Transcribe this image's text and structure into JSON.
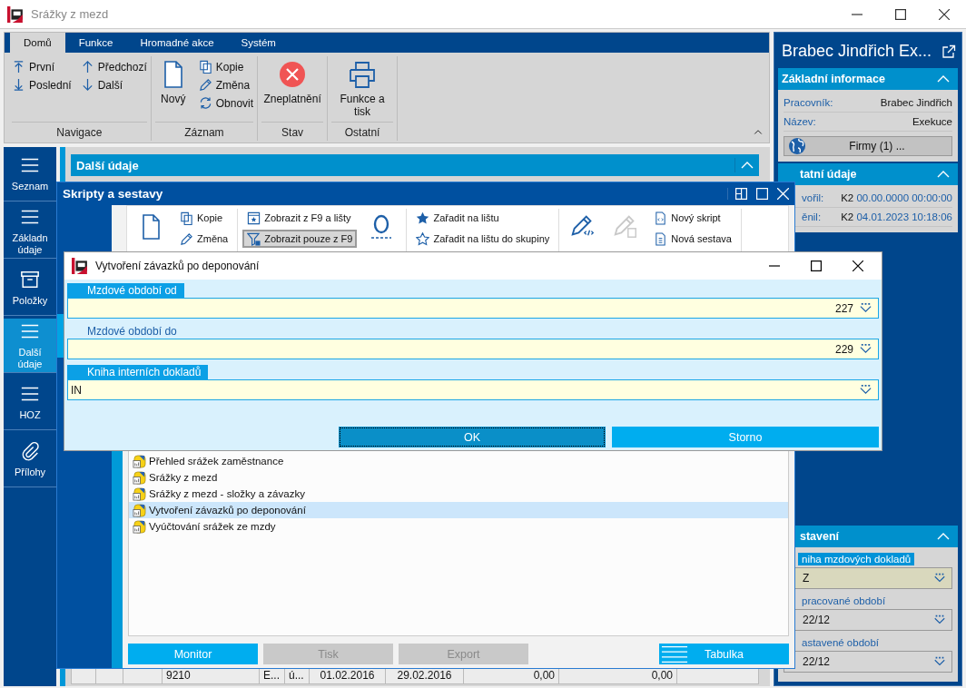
{
  "window": {
    "title": "Srážky z mezd"
  },
  "ribbon": {
    "tabs": [
      {
        "label": "Domů",
        "selected": true
      },
      {
        "label": "Funkce",
        "selected": false
      },
      {
        "label": "Hromadné akce",
        "selected": false
      },
      {
        "label": "Systém",
        "selected": false
      }
    ],
    "groups": [
      {
        "label": "Navigace",
        "small": [
          "První",
          "Předchozí",
          "Poslední",
          "Další"
        ]
      },
      {
        "label": "Záznam",
        "large": [
          "Nový"
        ],
        "small": [
          "Kopie",
          "Změna",
          "Obnovit"
        ]
      },
      {
        "label": "Stav",
        "large": [
          "Zneplatnění"
        ]
      },
      {
        "label": "Ostatní",
        "large": [
          "Funkce a tisk"
        ]
      }
    ]
  },
  "nav": [
    {
      "label": "Seznam",
      "selected": false
    },
    {
      "label": "Základn údaje",
      "selected": false
    },
    {
      "label": "Položky",
      "selected": false
    },
    {
      "label": "Další údaje",
      "selected": true
    },
    {
      "label": "HOZ",
      "selected": false
    },
    {
      "label": "Přílohy",
      "selected": false
    }
  ],
  "content": {
    "title": "Další údaje",
    "row": [
      "9210",
      "E...",
      "ú...",
      "01.02.2016",
      "29.02.2016",
      "0,00",
      "0,00"
    ]
  },
  "detail": {
    "title": "Brabec Jindřich Ex...",
    "info": {
      "title": "Základní informace",
      "rows": [
        {
          "label": "Pracovník:",
          "value": "Brabec Jindřich"
        },
        {
          "label": "Název:",
          "value": "Exekuce"
        }
      ],
      "button": "Firmy (1) ..."
    },
    "other": {
      "title": "tatní údaje",
      "rows": [
        {
          "label": "vořil:",
          "user": "K2",
          "date": "00.00.0000 00:00:00"
        },
        {
          "label": "ěnil:",
          "user": "K2",
          "date": "04.01.2023 10:18:06"
        }
      ]
    },
    "settings": {
      "title": "stavení",
      "fields": [
        {
          "label": "niha mzdových dokladů",
          "value": "Z",
          "highlighted": true
        },
        {
          "label": "pracované období",
          "value": "22/12",
          "highlighted": false
        },
        {
          "label": "astavené období",
          "value": "22/12",
          "highlighted": false
        }
      ]
    }
  },
  "scripts": {
    "title": "Skripty a sestavy",
    "toolbar": [
      {
        "label": "Kopie",
        "pressed": false
      },
      {
        "label": "Změna",
        "pressed": false
      },
      {
        "label": "Zobrazit z F9 a lišty",
        "pressed": false
      },
      {
        "label": "Zobrazit pouze z F9",
        "pressed": true
      },
      {
        "label": "Zařadit na lištu",
        "pressed": false
      },
      {
        "label": "Zařadit na lištu do skupiny",
        "pressed": false
      },
      {
        "label": "Nový skript",
        "pressed": false
      },
      {
        "label": "Nová sestava",
        "pressed": false
      }
    ],
    "list": [
      {
        "label": "Přehled srážek zaměstnance",
        "selected": false
      },
      {
        "label": "Srážky z mezd",
        "selected": false
      },
      {
        "label": "Srážky z mezd - složky a závazky",
        "selected": false
      },
      {
        "label": "Vytvoření závazků po deponování",
        "selected": true
      },
      {
        "label": "Vyúčtování srážek ze mzdy",
        "selected": false
      }
    ],
    "buttons": [
      {
        "label": "Monitor",
        "disabled": false
      },
      {
        "label": "Tisk",
        "disabled": true
      },
      {
        "label": "Export",
        "disabled": true
      },
      {
        "label": "Tabulka",
        "disabled": false
      }
    ]
  },
  "dialog": {
    "title": "Vytvoření závazků po deponování",
    "fields": [
      {
        "label": "Mzdové období od",
        "value": "227",
        "kind": "number",
        "highlighted": true
      },
      {
        "label": "Mzdové období do",
        "value": "229",
        "kind": "number",
        "highlighted": false
      },
      {
        "label": "Kniha interních dokladů",
        "value": "IN",
        "kind": "text",
        "highlighted": true
      }
    ],
    "buttons": [
      {
        "label": "OK",
        "focused": true
      },
      {
        "label": "Storno",
        "focused": false
      }
    ]
  }
}
